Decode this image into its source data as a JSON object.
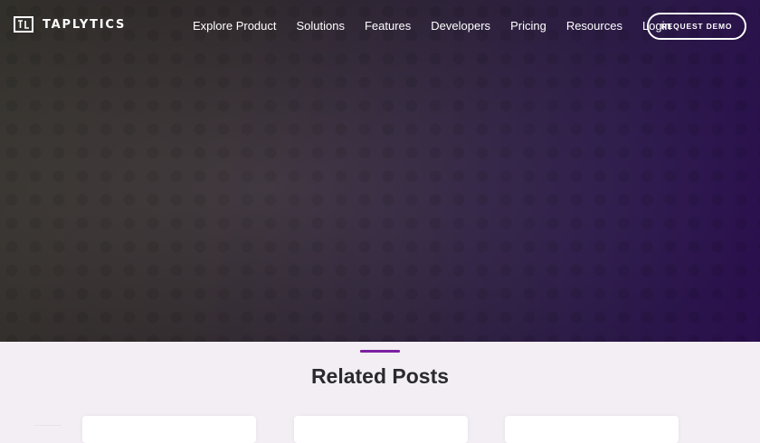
{
  "brand": {
    "name": "TAPLYTICS"
  },
  "nav": {
    "links": [
      "Explore Product",
      "Solutions",
      "Features",
      "Developers",
      "Pricing",
      "Resources",
      "Login"
    ],
    "cta": "REQUEST DEMO"
  },
  "related": {
    "title": "Related Posts"
  },
  "colors": {
    "accent": "#7b1fa2",
    "hero_start": "#3d3a34",
    "hero_end": "#33125e",
    "section_bg": "#f2eef4"
  }
}
